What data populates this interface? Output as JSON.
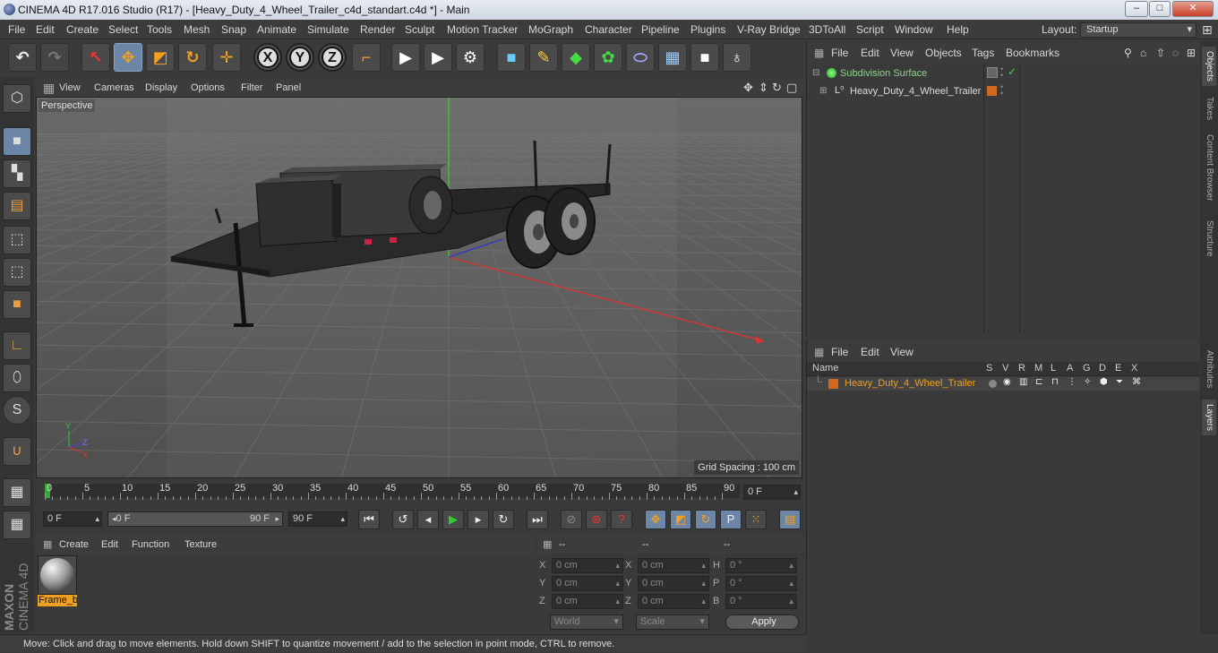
{
  "window": {
    "title": "CINEMA 4D R17.016 Studio (R17) - [Heavy_Duty_4_Wheel_Trailer_c4d_standart.c4d *] - Main",
    "min": "–",
    "max": "□",
    "close": "✕"
  },
  "menubar": {
    "items": [
      "File",
      "Edit",
      "Create",
      "Select",
      "Tools",
      "Mesh",
      "Snap",
      "Animate",
      "Simulate",
      "Render",
      "Sculpt",
      "Motion Tracker",
      "MoGraph",
      "Character",
      "Pipeline",
      "Plugins",
      "V-Ray Bridge",
      "3DToAll",
      "Script",
      "Window",
      "Help"
    ],
    "layout_label": "Layout:",
    "layout_value": "Startup"
  },
  "toolbar": {
    "axis_x": "X",
    "axis_y": "Y",
    "axis_z": "Z"
  },
  "viewport": {
    "menu": [
      "View",
      "Cameras",
      "Display",
      "Options",
      "Filter",
      "Panel"
    ],
    "label": "Perspective",
    "grid_spacing": "Grid Spacing : 100 cm",
    "axis_x": "X",
    "axis_y": "Y",
    "axis_z": "Z"
  },
  "timeline": {
    "ticks": [
      "0",
      "5",
      "10",
      "15",
      "20",
      "25",
      "30",
      "35",
      "40",
      "45",
      "50",
      "55",
      "60",
      "65",
      "70",
      "75",
      "80",
      "85",
      "90"
    ],
    "current_frame": "0 F",
    "start_field": "0 F",
    "range_start": "0 F",
    "range_end": "90 F",
    "end_field": "90 F"
  },
  "materials": {
    "menu": [
      "Create",
      "Edit",
      "Function",
      "Texture"
    ],
    "items": [
      {
        "name": "Frame_b"
      }
    ]
  },
  "coords": {
    "headers": [
      "--",
      "--",
      "--"
    ],
    "rows": [
      {
        "a": "X",
        "av": "0 cm",
        "b": "X",
        "bv": "0 cm",
        "c": "H",
        "cv": "0 °"
      },
      {
        "a": "Y",
        "av": "0 cm",
        "b": "Y",
        "bv": "0 cm",
        "c": "P",
        "cv": "0 °"
      },
      {
        "a": "Z",
        "av": "0 cm",
        "b": "Z",
        "bv": "0 cm",
        "c": "B",
        "cv": "0 °"
      }
    ],
    "world": "World",
    "scale": "Scale",
    "apply": "Apply"
  },
  "status": "Move: Click and drag to move elements. Hold down SHIFT to quantize movement / add to the selection in point mode, CTRL to remove.",
  "objects": {
    "menu": [
      "File",
      "Edit",
      "View",
      "Objects",
      "Tags",
      "Bookmarks"
    ],
    "items": [
      {
        "name": "Subdivision Surface"
      },
      {
        "name": "Heavy_Duty_4_Wheel_Trailer"
      }
    ]
  },
  "layers": {
    "menu": [
      "File",
      "Edit",
      "View"
    ],
    "name_header": "Name",
    "flags": [
      "S",
      "V",
      "R",
      "M",
      "L",
      "A",
      "G",
      "D",
      "E",
      "X"
    ],
    "items": [
      {
        "name": "Heavy_Duty_4_Wheel_Trailer",
        "color": "#d0691d"
      }
    ]
  },
  "sidetabs": [
    "Objects",
    "Takes",
    "Content Browser",
    "Structure",
    "Attributes",
    "Layers"
  ],
  "brand": {
    "maxon": "MAXON",
    "product": "CINEMA 4D"
  },
  "colors": {
    "accent": "#6e86a6",
    "layer": "#d0691d",
    "selected_text": "#f0a020"
  }
}
